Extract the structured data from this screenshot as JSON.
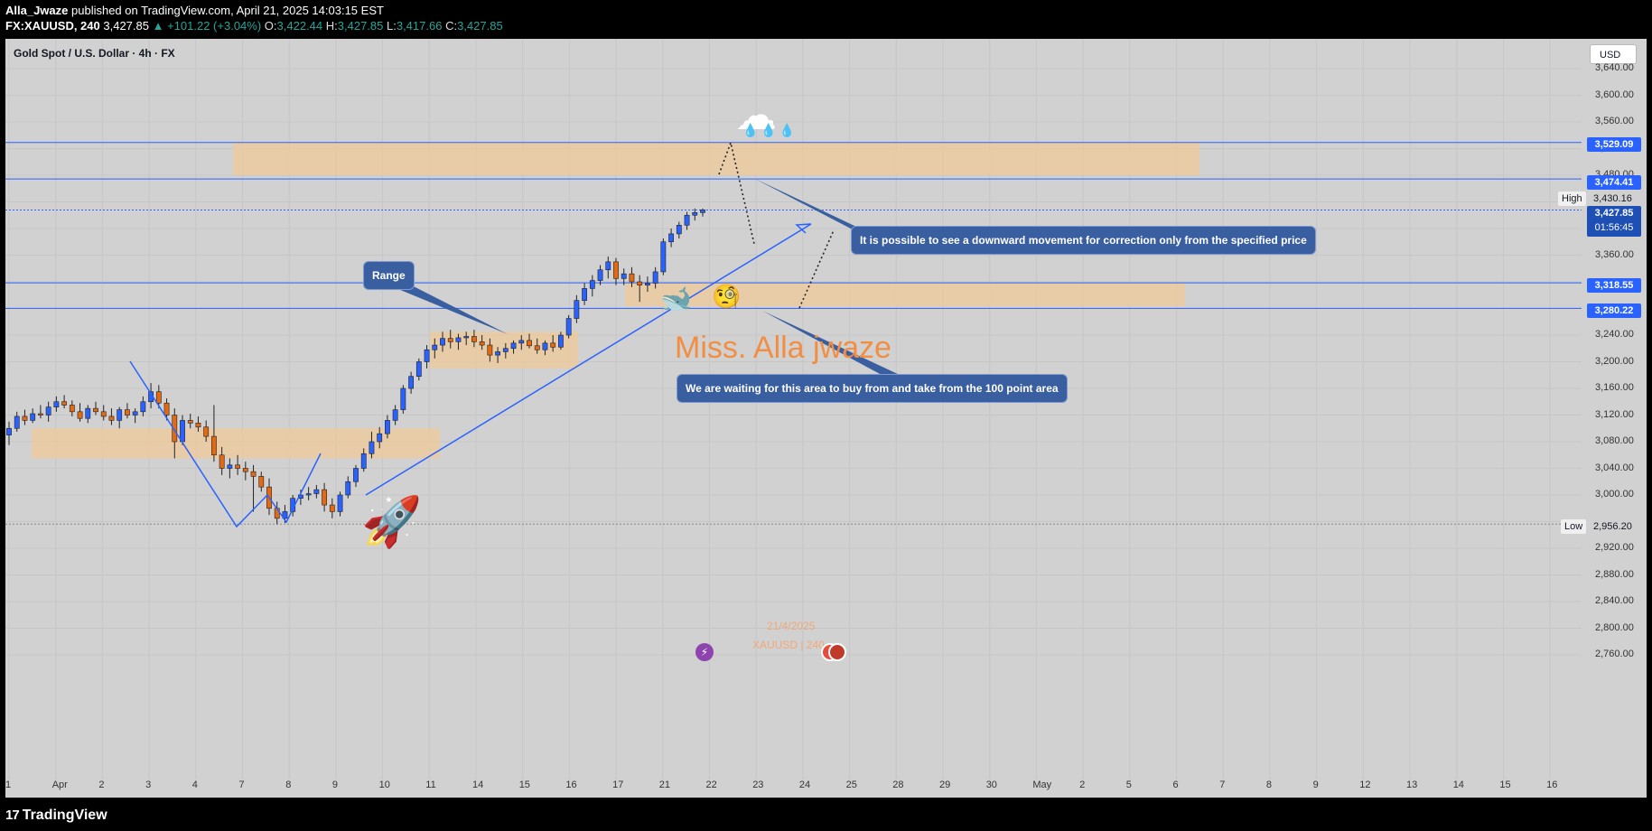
{
  "header": {
    "author": "Alla_Jwaze",
    "published": "published on TradingView.com, April 21, 2025 14:03:15 EST",
    "symbol": "FX:XAUUSD, 240",
    "last": "3,427.85",
    "change": "▲ +101.22 (+3.04%)",
    "open_label": "O:",
    "open": "3,422.44",
    "high_label": "H:",
    "high": "3,427.85",
    "low_label": "L:",
    "low": "3,417.66",
    "close_label": "C:",
    "close": "3,427.85"
  },
  "chart_title": "Gold Spot / U.S. Dollar · 4h · FX",
  "currency": "USD",
  "y_ticks": [
    "3,640.00",
    "3,600.00",
    "3,560.00",
    "3,520.00",
    "3,480.00",
    "3,400.00",
    "3,360.00",
    "3,240.00",
    "3,200.00",
    "3,160.00",
    "3,120.00",
    "3,080.00",
    "3,040.00",
    "3,000.00",
    "2,920.00",
    "2,880.00",
    "2,840.00",
    "2,800.00",
    "2,760.00"
  ],
  "x_ticks": [
    "1",
    "Apr",
    "2",
    "3",
    "4",
    "7",
    "8",
    "9",
    "10",
    "11",
    "14",
    "15",
    "16",
    "17",
    "21",
    "22",
    "23",
    "24",
    "25",
    "28",
    "29",
    "30",
    "May",
    "2",
    "5",
    "6",
    "7",
    "8",
    "9",
    "12",
    "13",
    "14",
    "15",
    "16"
  ],
  "price_tags": {
    "r1": "3,529.09",
    "r2": "3,474.41",
    "current": "3,427.85",
    "countdown": "01:56:45",
    "s1": "3,318.55",
    "s2": "3,280.22"
  },
  "high": {
    "key": "High",
    "value": "3,430.16"
  },
  "low": {
    "key": "Low",
    "value": "2,956.20"
  },
  "callouts": {
    "range": "Range",
    "down": "It is possible to see a downward movement for correction only from the specified price",
    "buy": "We are waiting for this area to buy from and take from the 100 point area"
  },
  "watermark": "Miss. Alla jwaze",
  "watermark_date": "21/4/2025",
  "watermark_symbol": "XAUUSD | 240",
  "footer_logo": "TradingView",
  "colors": {
    "up": "#2962ff",
    "down": "#e36a12",
    "zone": "#efc99a",
    "line": "#2962ff",
    "chart_bg": "#d1d1d1"
  },
  "icons": [
    "rain-cloud-icon",
    "whale-icon",
    "monocle-face-icon",
    "rocket-icon",
    "lightning-icon",
    "us-flag-icon",
    "tradingview-logo-icon"
  ],
  "chart_data": {
    "type": "candlestick",
    "title": "Gold Spot / U.S. Dollar · 4h · FX",
    "ylim": [
      2740,
      3665
    ],
    "x_ticks": [
      "1",
      "Apr",
      "2",
      "3",
      "4",
      "7",
      "8",
      "9",
      "10",
      "11",
      "14",
      "15",
      "16",
      "17",
      "21",
      "22",
      "23",
      "24",
      "25",
      "28",
      "29",
      "30",
      "May",
      "2",
      "5",
      "6",
      "7",
      "8",
      "9",
      "12",
      "13",
      "14",
      "15",
      "16"
    ],
    "horizontal_levels": [
      3529.09,
      3474.41,
      3318.55,
      3280.22
    ],
    "high": 3430.16,
    "low": 2956.2,
    "last": 3427.85,
    "zones": [
      {
        "label": "resistance",
        "from": 3480,
        "to": 3530
      },
      {
        "label": "buy area",
        "from": 3283,
        "to": 3318
      },
      {
        "label": "range",
        "from": 3190,
        "to": 3245
      },
      {
        "label": "support",
        "from": 3055,
        "to": 3100
      }
    ],
    "candles_ohlc": [
      [
        3090,
        3110,
        3075,
        3100
      ],
      [
        3100,
        3125,
        3095,
        3118
      ],
      [
        3118,
        3128,
        3105,
        3112
      ],
      [
        3112,
        3130,
        3108,
        3122
      ],
      [
        3122,
        3135,
        3115,
        3120
      ],
      [
        3120,
        3140,
        3110,
        3132
      ],
      [
        3132,
        3148,
        3125,
        3140
      ],
      [
        3140,
        3150,
        3130,
        3135
      ],
      [
        3135,
        3142,
        3118,
        3125
      ],
      [
        3125,
        3138,
        3110,
        3115
      ],
      [
        3115,
        3135,
        3108,
        3130
      ],
      [
        3130,
        3140,
        3120,
        3125
      ],
      [
        3125,
        3135,
        3112,
        3118
      ],
      [
        3118,
        3130,
        3105,
        3112
      ],
      [
        3112,
        3132,
        3100,
        3128
      ],
      [
        3128,
        3138,
        3115,
        3120
      ],
      [
        3120,
        3130,
        3108,
        3125
      ],
      [
        3125,
        3148,
        3118,
        3140
      ],
      [
        3140,
        3168,
        3130,
        3155
      ],
      [
        3155,
        3165,
        3130,
        3138
      ],
      [
        3138,
        3145,
        3112,
        3120
      ],
      [
        3120,
        3130,
        3055,
        3080
      ],
      [
        3080,
        3120,
        3075,
        3112
      ],
      [
        3112,
        3122,
        3100,
        3108
      ],
      [
        3108,
        3118,
        3095,
        3102
      ],
      [
        3102,
        3112,
        3080,
        3088
      ],
      [
        3088,
        3135,
        3050,
        3060
      ],
      [
        3060,
        3072,
        3030,
        3040
      ],
      [
        3040,
        3055,
        3025,
        3045
      ],
      [
        3045,
        3060,
        3030,
        3040
      ],
      [
        3040,
        3050,
        3022,
        3035
      ],
      [
        3035,
        3045,
        2975,
        3028
      ],
      [
        3028,
        3035,
        3005,
        3012
      ],
      [
        3012,
        3025,
        2970,
        2980
      ],
      [
        2980,
        2990,
        2956,
        2965
      ],
      [
        2965,
        2985,
        2958,
        2975
      ],
      [
        2975,
        3000,
        2968,
        2995
      ],
      [
        2995,
        3008,
        2985,
        3000
      ],
      [
        3000,
        3012,
        2992,
        3002
      ],
      [
        3002,
        3015,
        2995,
        3008
      ],
      [
        3008,
        3018,
        2975,
        2985
      ],
      [
        2985,
        2995,
        2965,
        2975
      ],
      [
        2975,
        3005,
        2968,
        3000
      ],
      [
        3000,
        3028,
        2995,
        3020
      ],
      [
        3020,
        3045,
        3012,
        3040
      ],
      [
        3040,
        3070,
        3035,
        3062
      ],
      [
        3062,
        3095,
        3055,
        3080
      ],
      [
        3080,
        3102,
        3070,
        3092
      ],
      [
        3092,
        3120,
        3085,
        3112
      ],
      [
        3112,
        3135,
        3105,
        3128
      ],
      [
        3128,
        3165,
        3122,
        3160
      ],
      [
        3160,
        3185,
        3152,
        3178
      ],
      [
        3178,
        3205,
        3172,
        3200
      ],
      [
        3200,
        3225,
        3190,
        3218
      ],
      [
        3218,
        3235,
        3205,
        3225
      ],
      [
        3225,
        3245,
        3215,
        3235
      ],
      [
        3235,
        3248,
        3220,
        3230
      ],
      [
        3230,
        3242,
        3218,
        3236
      ],
      [
        3236,
        3245,
        3225,
        3238
      ],
      [
        3238,
        3248,
        3222,
        3230
      ],
      [
        3230,
        3240,
        3218,
        3225
      ],
      [
        3225,
        3235,
        3200,
        3210
      ],
      [
        3210,
        3222,
        3198,
        3215
      ],
      [
        3215,
        3228,
        3205,
        3220
      ],
      [
        3220,
        3232,
        3212,
        3228
      ],
      [
        3228,
        3240,
        3218,
        3232
      ],
      [
        3232,
        3242,
        3220,
        3224
      ],
      [
        3224,
        3235,
        3212,
        3218
      ],
      [
        3218,
        3232,
        3210,
        3228
      ],
      [
        3228,
        3240,
        3215,
        3222
      ],
      [
        3222,
        3245,
        3218,
        3240
      ],
      [
        3240,
        3270,
        3235,
        3265
      ],
      [
        3265,
        3300,
        3258,
        3292
      ],
      [
        3292,
        3318,
        3285,
        3310
      ],
      [
        3310,
        3330,
        3298,
        3322
      ],
      [
        3322,
        3345,
        3315,
        3338
      ],
      [
        3338,
        3358,
        3325,
        3350
      ],
      [
        3350,
        3356,
        3315,
        3325
      ],
      [
        3325,
        3340,
        3315,
        3332
      ],
      [
        3332,
        3342,
        3312,
        3320
      ],
      [
        3320,
        3330,
        3290,
        3315
      ],
      [
        3315,
        3328,
        3305,
        3318
      ],
      [
        3318,
        3342,
        3310,
        3335
      ],
      [
        3335,
        3385,
        3330,
        3380
      ],
      [
        3380,
        3400,
        3372,
        3392
      ],
      [
        3392,
        3410,
        3385,
        3405
      ],
      [
        3405,
        3425,
        3398,
        3420
      ],
      [
        3420,
        3430,
        3412,
        3424
      ],
      [
        3424,
        3430,
        3418,
        3428
      ]
    ]
  }
}
